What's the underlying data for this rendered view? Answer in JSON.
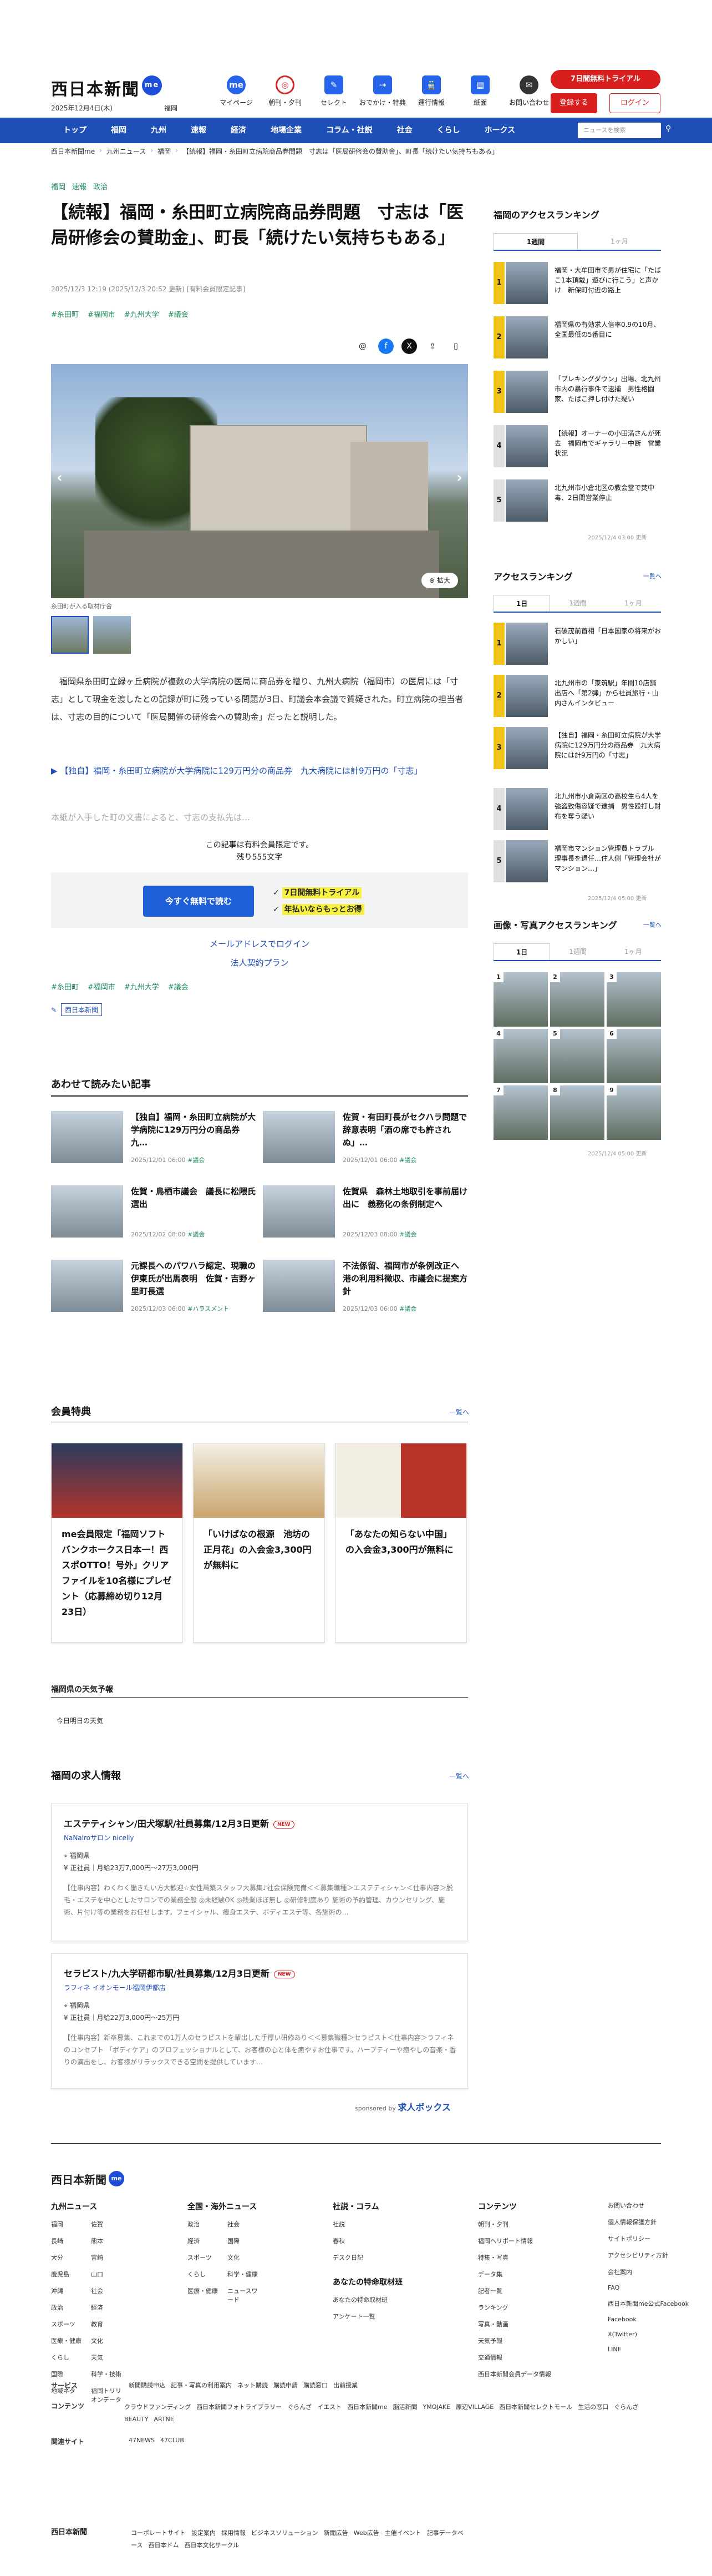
{
  "header": {
    "logo": "西日本新聞",
    "logo_badge": "me",
    "date": "2025年12月4日(木)",
    "place": "福岡",
    "icons": [
      {
        "label": "マイページ",
        "glyph": "me"
      },
      {
        "label": "朝刊・夕刊",
        "glyph": "◎"
      },
      {
        "label": "セレクト",
        "glyph": "✎"
      },
      {
        "label": "おでかけ・特典",
        "glyph": "⇢"
      },
      {
        "label": "運行情報",
        "glyph": "🚆"
      },
      {
        "label": "紙面",
        "glyph": "▤"
      },
      {
        "label": "お問い合わせ",
        "glyph": "✉"
      }
    ],
    "trial": "7日間無料トライアル",
    "register": "登録する",
    "login": "ログイン"
  },
  "nav": {
    "items": [
      "トップ",
      "福岡",
      "九州",
      "速報",
      "経済",
      "地場企業",
      "コラム・社説",
      "社会",
      "くらし",
      "ホークス"
    ],
    "search_placeholder": "ニュースを検索"
  },
  "breadcrumb": [
    "西日本新聞me",
    "九州ニュース",
    "福岡",
    "【続報】福岡・糸田町立病院商品券問題　寸志は「医局研修会の賛助金」、町長「続けたい気持ちもある」"
  ],
  "article": {
    "categories": [
      "福岡",
      "速報",
      "政治"
    ],
    "title": "【続報】福岡・糸田町立病院商品券問題　寸志は「医局研修会の賛助金」、町長「続けたい気持ちもある」",
    "meta": "2025/12/3 12:19 (2025/12/3 20:52 更新)  [有料会員限定記事]",
    "tags": [
      "#糸田町",
      "#福岡市",
      "#九州大学",
      "#議会"
    ],
    "caption": "糸田町が入る取材庁舎",
    "zoom": "拡大",
    "lead": "福岡県糸田町立緑ヶ丘病院が複数の大学病院の医局に商品券を贈り、九州大病院（福岡市）の医局には「寸志」として現金を渡したとの記録が町に残っている問題が3日、町議会本会議で質疑された。町立病院の担当者は、寸志の目的について「医局開催の研修会への賛助金」だったと説明した。",
    "related_link": "【独自】福岡・糸田町立病院が大学病院に129万円分の商品券　九大病院には計9万円の「寸志」",
    "fade": "本紙が入手した町の文書によると、寸志の支払先は…",
    "paywall_note": "この記事は有料会員限定です。",
    "paywall_remain": "残り555文字",
    "pay_button": "今すぐ無料で読む",
    "pay_checks": [
      "7日間無料トライアル",
      "年払いならもっとお得"
    ],
    "mail_login": "メールアドレスでログイン",
    "corp_login": "法人契約プラン",
    "tags_bottom": [
      "#糸田町",
      "#福岡市",
      "#九州大学",
      "#議会"
    ],
    "author": "西日本新聞"
  },
  "related": {
    "heading": "あわせて読みたい記事",
    "items": [
      {
        "title": "【独自】福岡・糸田町立病院が大学病院に129万円分の商品券　九…",
        "date": "2025/12/01 06:00",
        "tag": "#議会"
      },
      {
        "title": "佐賀・有田町長がセクハラ問題で辞意表明「酒の席でも許されぬ」…",
        "date": "2025/12/01 06:00",
        "tag": "#議会"
      },
      {
        "title": "佐賀・鳥栖市議会　議長に松隈氏選出",
        "date": "2025/12/02 08:00",
        "tag": "#議会"
      },
      {
        "title": "佐賀県　森林土地取引を事前届け出に　義務化の条例制定へ",
        "date": "2025/12/03 08:00",
        "tag": "#議会"
      },
      {
        "title": "元課長へのパワハラ認定、現職の伊東氏が出馬表明　佐賀・吉野ヶ里町長選",
        "date": "2025/12/03 06:00",
        "tag": "#ハラスメント"
      },
      {
        "title": "不法係留、福岡市が条例改正へ　港の利用料徴収、市議会に提案方針",
        "date": "2025/12/03 06:00",
        "tag": "#議会"
      }
    ]
  },
  "perks": {
    "heading": "会員特典",
    "more": "一覧へ",
    "items": [
      {
        "title": "me会員限定「福岡ソフトバンクホークス日本一！西スポOTTO！号外」クリアファイルを10名様にプレゼント（応募締め切り12月23日）"
      },
      {
        "title": "「いけばなの根源　池坊の正月花」の入会金3,300円が無料に"
      },
      {
        "title": "「あなたの知らない中国」の入会金3,300円が無料に"
      }
    ]
  },
  "weather": {
    "heading": "福岡県の天気予報",
    "text": "今日明日の天気"
  },
  "jobs": {
    "heading": "福岡の求人情報",
    "more": "一覧へ",
    "items": [
      {
        "title": "エステティシャン/田犬塚駅/社員募集/12月3日更新",
        "new": "NEW",
        "company": "NaNairoサロン nicelly",
        "location": "福岡県",
        "salary": "正社員｜月給23万7,000円〜27万3,000円",
        "desc": "【仕事内容】わくわく働きたい方大歓迎☆女性萬築スタッフ大募集♪社会保険完備＜＜募集職種＞エステティシャン＜仕事内容＞脱毛・エステを中心としたサロンでの業務全般 ◎未経験OK ◎残業ほぼ無し ◎研修制度あり 施術の予約管理、カウンセリング、施術、片付け等の業務をお任せします。フェイシャル、痩身エステ、ボディエステ等、各施術の…"
      },
      {
        "title": "セラピスト/九大学研都市駅/社員募集/12月3日更新",
        "new": "NEW",
        "company": "ラフィネ イオンモール福岡伊都店",
        "location": "福岡県",
        "salary": "正社員｜月給22万3,000円〜25万円",
        "desc": "【仕事内容】新卒募集、これまでの1万人のセラピストを輩出した手厚い研修あり＜＜募集職種＞セラピスト＜仕事内容＞ラフィネのコンセプト 「ボディケア」のプロフェッショナルとして、お客様の心と体を癒やすお仕事です。ハーブティーや癒やしの音楽・香りの演出をし、お客様がリラックスできる空間を提供しています…"
      }
    ],
    "sponsor_label": "sponsored by",
    "sponsor": "求人ボックス"
  },
  "sidebar": {
    "ranking_heading": "福岡のアクセスランキング",
    "ranking_tabs": [
      "1週間",
      "1ヶ月"
    ],
    "ranking": [
      "福岡・大牟田市で男が住宅に「たばこ1本頂戴」遊びに行こう」と声かけ　新保町付近の路上",
      "福岡県の有効求人倍率0.9の10月、全国最低の5番目に",
      "「ブレキングダウン」出場、北九州市内の暴行事件で逮捕　男性格闘家、たばこ押し付けた疑い",
      "【続報】オーナーの小田満さんが死去　福岡市でギャラリー中断　営業状況",
      "北九州市小倉北区の教会堂で焚中毒、2日間営業停止"
    ],
    "ranking_time": "2025/12/4 03:00 更新",
    "access_heading": "アクセスランキング",
    "access_more": "一覧へ",
    "access_tabs": [
      "1日",
      "1週間",
      "1ヶ月"
    ],
    "access": [
      "石破茂前首相「日本国家の将来がおかしい」",
      "北九州市の「東筑駅」年間10店舗出店へ「第2弾」から社員旅行・山内さんインタビュー",
      "【独自】福岡・糸田町立病院が大学病院に129万円分の商品券　九大病院には計9万円の「寸志」",
      "北九州市小倉南区の高校生ら4人を強盗致傷容疑で逮捕　男性殴打し財布を奪う疑い",
      "福岡市マンション管理費トラブル　理事長を退任…住人側「管理会社がマンション…」"
    ],
    "access_time": "2025/12/4 05:00 更新",
    "photo_heading": "画像・写真アクセスランキング",
    "photo_more": "一覧へ",
    "photo_tabs": [
      "1日",
      "1週間",
      "1ヶ月"
    ],
    "photo_nums": [
      "1",
      "2",
      "3",
      "4",
      "5",
      "6",
      "7",
      "8",
      "9"
    ],
    "photo_time": "2025/12/4 05:00 更新"
  },
  "footer": {
    "logo": "西日本新聞",
    "logo_badge": "me",
    "columns": [
      {
        "heading": "九州ニュース",
        "items": [
          "福岡",
          "佐賀",
          "長崎",
          "熊本",
          "大分",
          "宮崎",
          "鹿児島",
          "山口",
          "沖縄",
          "社会",
          "政治",
          "経済",
          "スポーツ",
          "教育",
          "医療・健康",
          "文化",
          "くらし",
          "天気",
          "国際",
          "科学・技術",
          "地域ネタ",
          "福岡トリリオンデータ"
        ]
      },
      {
        "heading": "全国・海外ニュース",
        "items": [
          "政治",
          "社会",
          "経済",
          "国際",
          "スポーツ",
          "文化",
          "くらし",
          "科学・健康",
          "医療・健康",
          "ニュースワード"
        ]
      },
      {
        "heading": "社説・コラム",
        "items": [
          "社説",
          "春秋",
          "デスク日記"
        ]
      },
      {
        "heading": "コンテンツ",
        "items": [
          "朝刊・夕刊",
          "福岡ヘリポート情報",
          "特集・写真",
          "データ集",
          "記者一覧",
          "ランキング",
          "写真・動画",
          "天気予報",
          "交通情報",
          "西日本新聞会員データ情報"
        ]
      },
      {
        "heading": "",
        "items": [
          "お問い合わせ",
          "個人情報保護方針",
          "サイトポリシー",
          "アクセシビリティ方針",
          "会社案内",
          "FAQ",
          "西日本新聞me公式Facebook",
          "Facebook",
          "X(Twitter)",
          "LINE"
        ]
      }
    ],
    "extra_heading": "あなたの特命取材班",
    "extra_items": [
      "あなたの特命取材班",
      "アンケート一覧"
    ],
    "rows": [
      {
        "label": "サービス",
        "items": [
          "新聞購読申込",
          "記事・写真の利用案内",
          "ネット購読",
          "購読申請",
          "購読窓口",
          "出前授業"
        ]
      },
      {
        "label": "コンテンツ",
        "items": [
          "クラウドファンディング",
          "西日本新聞フォトライブラリー",
          "ぐらんざ",
          "イエスト",
          "西日本新聞me",
          "脳活新聞",
          "YMOJAKE",
          "原辺VILLAGE",
          "西日本新聞セレクトモール",
          "生活の窓口",
          "ぐらんざBEAUTY",
          "ARTNE"
        ]
      },
      {
        "label": "関連サイト",
        "items": [
          "47NEWS",
          "47CLUB"
        ]
      }
    ],
    "copy_logo": "西日本新聞",
    "copy_links": [
      "コーポレートサイト",
      "設定案内",
      "採用情報",
      "ビジネスソリューション",
      "新聞広告",
      "Web広告",
      "主催イベント",
      "記事データベース",
      "西日本ドム",
      "西日本文化サークル"
    ]
  }
}
